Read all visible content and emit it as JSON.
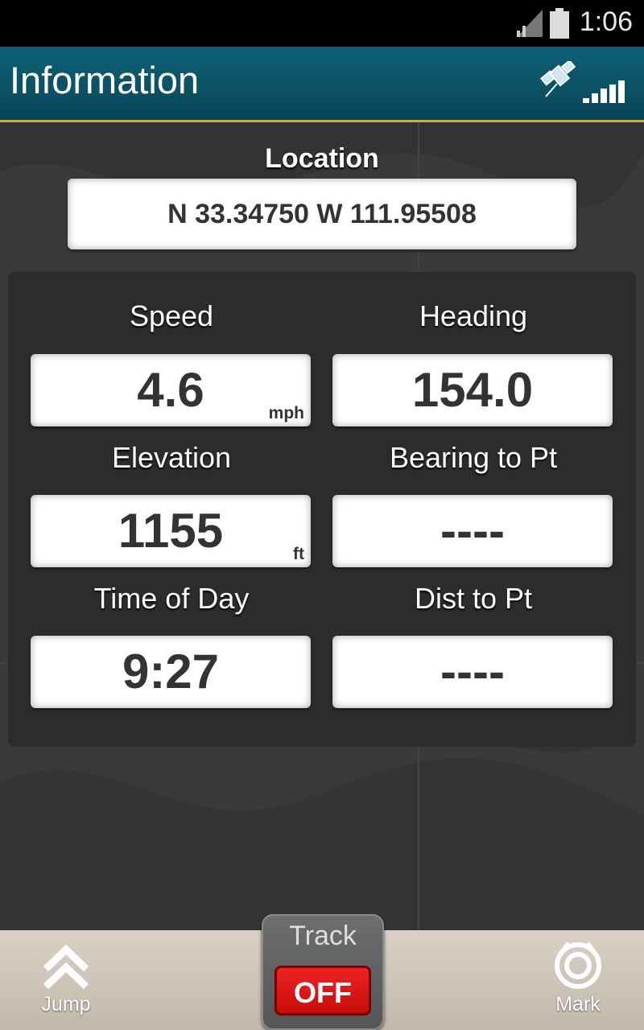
{
  "status_bar": {
    "time": "1:06"
  },
  "header": {
    "title": "Information"
  },
  "location": {
    "label": "Location",
    "value": "N 33.34750 W 111.95508"
  },
  "fields": {
    "speed": {
      "label": "Speed",
      "value": "4.6",
      "unit": "mph"
    },
    "heading": {
      "label": "Heading",
      "value": "154.0"
    },
    "elevation": {
      "label": "Elevation",
      "value": "1155",
      "unit": "ft"
    },
    "bearing": {
      "label": "Bearing to Pt",
      "value": "----"
    },
    "time_of_day": {
      "label": "Time of Day",
      "value": "9:27"
    },
    "dist": {
      "label": "Dist to Pt",
      "value": "----"
    }
  },
  "bottom_bar": {
    "jump_label": "Jump",
    "track_label": "Track",
    "track_state": "OFF",
    "mark_label": "Mark"
  },
  "colors": {
    "header_bg": "#0c5266",
    "header_border": "#c9b43a",
    "off_button": "#e01818"
  },
  "icons": [
    "signal-icon",
    "battery-icon",
    "gps-satellite-icon",
    "signal-strength-icon",
    "jump-chevron-icon",
    "mark-target-icon"
  ]
}
